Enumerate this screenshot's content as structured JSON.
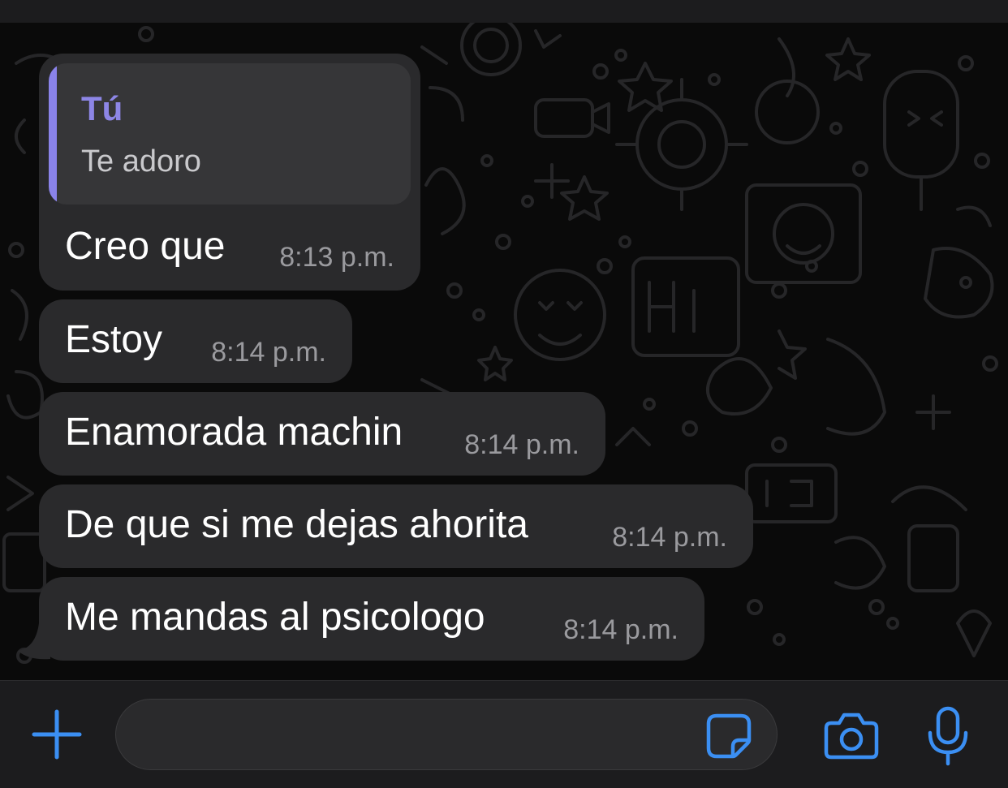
{
  "quoted_reply": {
    "author": "Tú",
    "text": "Te adoro",
    "author_color": "#8d86e6",
    "bar_color": "#8a83ea"
  },
  "messages": [
    {
      "text": "Creo que",
      "time": "8:13 p.m."
    },
    {
      "text": "Estoy",
      "time": "8:14 p.m."
    },
    {
      "text": "Enamorada machin",
      "time": "8:14 p.m."
    },
    {
      "text": "De que si me dejas ahorita",
      "time": "8:14 p.m."
    },
    {
      "text": "Me mandas al psicologo",
      "time": "8:14 p.m."
    }
  ],
  "composer": {
    "placeholder": "",
    "icons": [
      "plus-icon",
      "sticker-icon",
      "camera-icon",
      "microphone-icon"
    ],
    "accent_color": "#3b8ff3"
  },
  "colors": {
    "bubble": "#2a2a2c",
    "timestamp": "#9a9a9e",
    "background": "#0a0a0a"
  }
}
